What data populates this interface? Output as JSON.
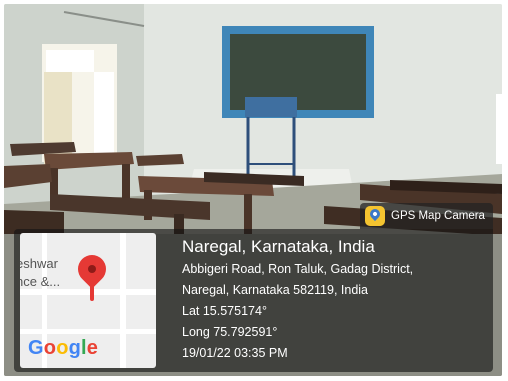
{
  "badge": {
    "icon": "gps-map-camera-app-icon",
    "label": "GPS Map Camera"
  },
  "map": {
    "partial_label": "eshwar\nnce &...",
    "logo": [
      "G",
      "o",
      "o",
      "g",
      "l",
      "e"
    ],
    "logo_colors": [
      "#4285F4",
      "#EA4335",
      "#FBBC05",
      "#4285F4",
      "#34A853",
      "#EA4335"
    ],
    "pin_icon": "map-pin-icon"
  },
  "info": {
    "title": "Naregal, Karnataka, India",
    "address_line1": "Abbigeri Road, Ron Taluk, Gadag District,",
    "address_line2": "Naregal, Karnataka 582119, India",
    "lat": "Lat 15.575174°",
    "long": "Long 75.792591°",
    "datetime": "19/01/22 03:35 PM"
  }
}
